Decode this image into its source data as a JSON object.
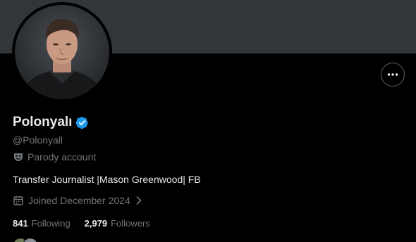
{
  "profile": {
    "display_name": "Polonyalı",
    "handle": "@Polonyall",
    "parody_label": "Parody account",
    "bio": "Transfer Journalist |Mason Greenwood| FB",
    "joined": "Joined December 2024",
    "following_count": "841",
    "following_label": "Following",
    "followers_count": "2,979",
    "followers_label": "Followers"
  },
  "colors": {
    "background": "#000000",
    "banner": "#333639",
    "primary_text": "#e7e9ea",
    "secondary_text": "#71767b",
    "verified_badge": "#1d9bf0"
  },
  "icons": {
    "verified": "verified-badge-icon",
    "parody": "parody-mask-icon",
    "calendar": "calendar-icon",
    "chevron": "chevron-right-icon",
    "more": "more-horizontal-icon"
  }
}
